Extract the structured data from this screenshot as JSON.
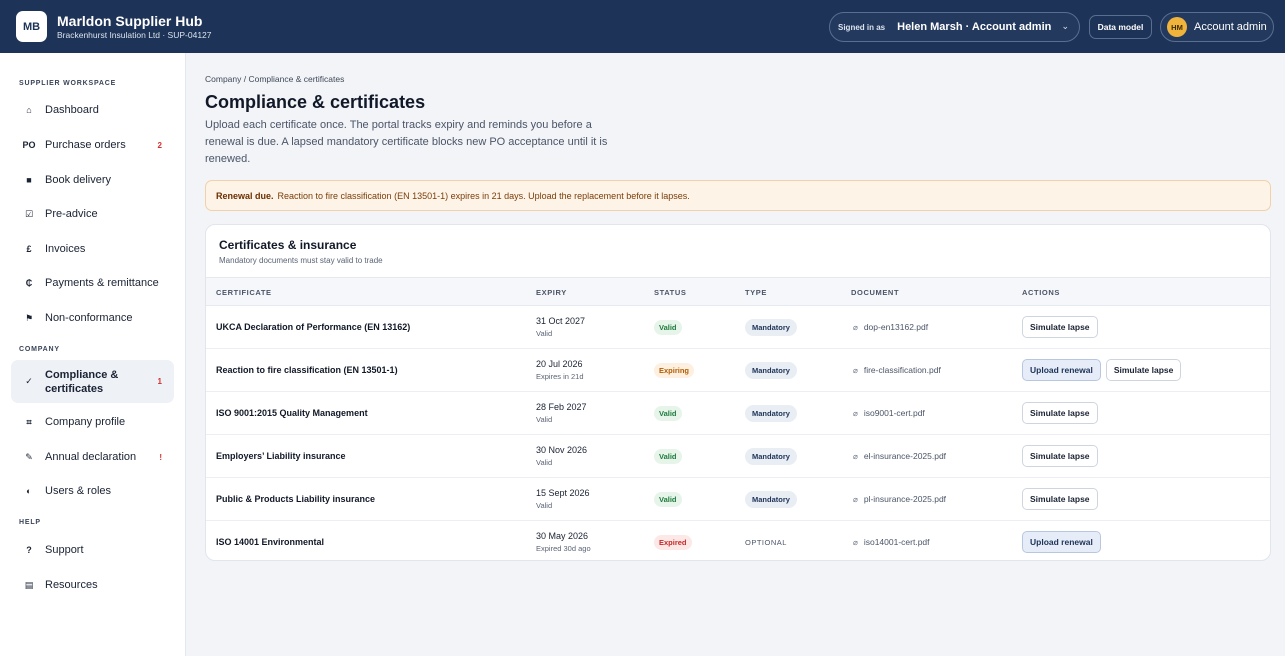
{
  "header": {
    "logo": "MB",
    "title": "Marldon Supplier Hub",
    "subtitle": "Brackenhurst Insulation Ltd · SUP-04127",
    "signed_in_label": "Signed in as",
    "signed_in_user": "Helen Marsh · Account admin",
    "data_model_label": "Data model",
    "account_initials": "HM",
    "account_label": "Account admin"
  },
  "sidebar": {
    "section_workspace": "SUPPLIER WORKSPACE",
    "section_company": "COMPANY",
    "section_help": "HELP",
    "items": [
      {
        "icon": "⌂",
        "label": "Dashboard",
        "badge": ""
      },
      {
        "icon": "PO",
        "label": "Purchase orders",
        "badge": "2"
      },
      {
        "icon": "■",
        "label": "Book delivery",
        "badge": ""
      },
      {
        "icon": "☑",
        "label": "Pre-advice",
        "badge": ""
      },
      {
        "icon": "£",
        "label": "Invoices",
        "badge": ""
      },
      {
        "icon": "₵",
        "label": "Payments & remittance",
        "badge": ""
      },
      {
        "icon": "⚑",
        "label": "Non-conformance",
        "badge": ""
      },
      {
        "icon": "✓",
        "label": "Compliance & certificates",
        "badge": "1"
      },
      {
        "icon": "⌗",
        "label": "Company profile",
        "badge": ""
      },
      {
        "icon": "✎",
        "label": "Annual declaration",
        "badge": "!"
      },
      {
        "icon": "◐",
        "label": "Users & roles",
        "badge": ""
      },
      {
        "icon": "?",
        "label": "Support",
        "badge": ""
      },
      {
        "icon": "▤",
        "label": "Resources",
        "badge": ""
      }
    ]
  },
  "main": {
    "breadcrumb": "Company / Compliance & certificates",
    "title": "Compliance & certificates",
    "description": "Upload each certificate once. The portal tracks expiry and reminds you before a renewal is due. A lapsed mandatory certificate blocks new PO acceptance until it is renewed.",
    "alert_strong": "Renewal due.",
    "alert_text": "Reaction to fire classification (EN 13501-1) expires in 21 days. Upload the replacement before it lapses."
  },
  "card": {
    "title": "Certificates & insurance",
    "subtitle": "Mandatory documents must stay valid to trade",
    "columns": [
      "CERTIFICATE",
      "EXPIRY",
      "STATUS",
      "TYPE",
      "DOCUMENT",
      "ACTIONS"
    ],
    "rows": [
      {
        "name": "UKCA Declaration of Performance (EN 13162)",
        "date": "31 Oct 2027",
        "date_sub": "Valid",
        "status": "Valid",
        "type": "Mandatory",
        "doc": "dop-en13162.pdf",
        "actions": [
          "Simulate lapse"
        ]
      },
      {
        "name": "Reaction to fire classification (EN 13501-1)",
        "date": "20 Jul 2026",
        "date_sub": "Expires in 21d",
        "status": "Expiring",
        "type": "Mandatory",
        "doc": "fire-classification.pdf",
        "actions": [
          "Upload renewal",
          "Simulate lapse"
        ]
      },
      {
        "name": "ISO 9001:2015 Quality Management",
        "date": "28 Feb 2027",
        "date_sub": "Valid",
        "status": "Valid",
        "type": "Mandatory",
        "doc": "iso9001-cert.pdf",
        "actions": [
          "Simulate lapse"
        ]
      },
      {
        "name": "Employers’ Liability insurance",
        "date": "30 Nov 2026",
        "date_sub": "Valid",
        "status": "Valid",
        "type": "Mandatory",
        "doc": "el-insurance-2025.pdf",
        "actions": [
          "Simulate lapse"
        ]
      },
      {
        "name": "Public & Products Liability insurance",
        "date": "15 Sept 2026",
        "date_sub": "Valid",
        "status": "Valid",
        "type": "Mandatory",
        "doc": "pl-insurance-2025.pdf",
        "actions": [
          "Simulate lapse"
        ]
      },
      {
        "name": "ISO 14001 Environmental",
        "date": "30 May 2026",
        "date_sub": "Expired 30d ago",
        "status": "Expired",
        "type": "OPTIONAL",
        "doc": "iso14001-cert.pdf",
        "actions": [
          "Upload renewal"
        ]
      }
    ]
  }
}
